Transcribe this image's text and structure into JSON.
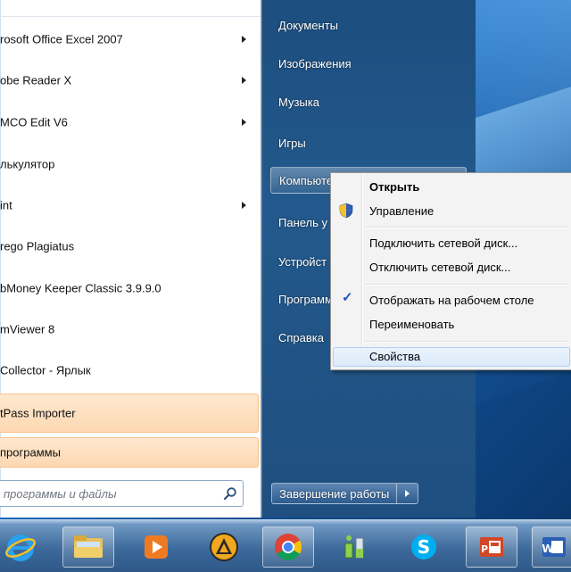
{
  "programs": [
    {
      "label": "rosoft Office Excel 2007",
      "has_submenu": true
    },
    {
      "label": "obe Reader X",
      "has_submenu": true
    },
    {
      "label": "MCO Edit V6",
      "has_submenu": true
    },
    {
      "label": "лькулятор",
      "has_submenu": false
    },
    {
      "label": "int",
      "has_submenu": true
    },
    {
      "label": "rego Plagiatus",
      "has_submenu": false
    },
    {
      "label": "bMoney Keeper Classic 3.9.9.0",
      "has_submenu": false
    },
    {
      "label": "mViewer 8",
      "has_submenu": false
    },
    {
      "label": "Collector - Ярлык",
      "has_submenu": false
    },
    {
      "label": "tPass Importer",
      "has_submenu": false,
      "highlighted": true
    }
  ],
  "all_programs_label": "программы",
  "search": {
    "placeholder": "программы и файлы"
  },
  "right_pane": {
    "items": [
      "Документы",
      "Изображения",
      "Музыка",
      "Игры",
      "Компьютер",
      "Панель у",
      "Устройст",
      "Программ",
      "Справка"
    ],
    "active_index": 4,
    "shutdown_label": "Завершение работы"
  },
  "context_menu": {
    "open": "Открыть",
    "manage": "Управление",
    "map_drive": "Подключить сетевой диск...",
    "disconnect_drive": "Отключить сетевой диск...",
    "show_on_desktop": "Отображать на рабочем столе",
    "rename": "Переименовать",
    "properties": "Свойства"
  },
  "colors": {
    "accent_blue": "#1c4e7f",
    "highlight_orange": "#fcd8b2",
    "check_blue": "#1c56c8"
  },
  "taskbar_icons": [
    "internet-explorer-icon",
    "explorer-folder-icon",
    "media-player-icon",
    "aimp-icon",
    "chrome-icon",
    "network-meter-icon",
    "skype-icon",
    "powerpoint-icon",
    "word-icon"
  ]
}
